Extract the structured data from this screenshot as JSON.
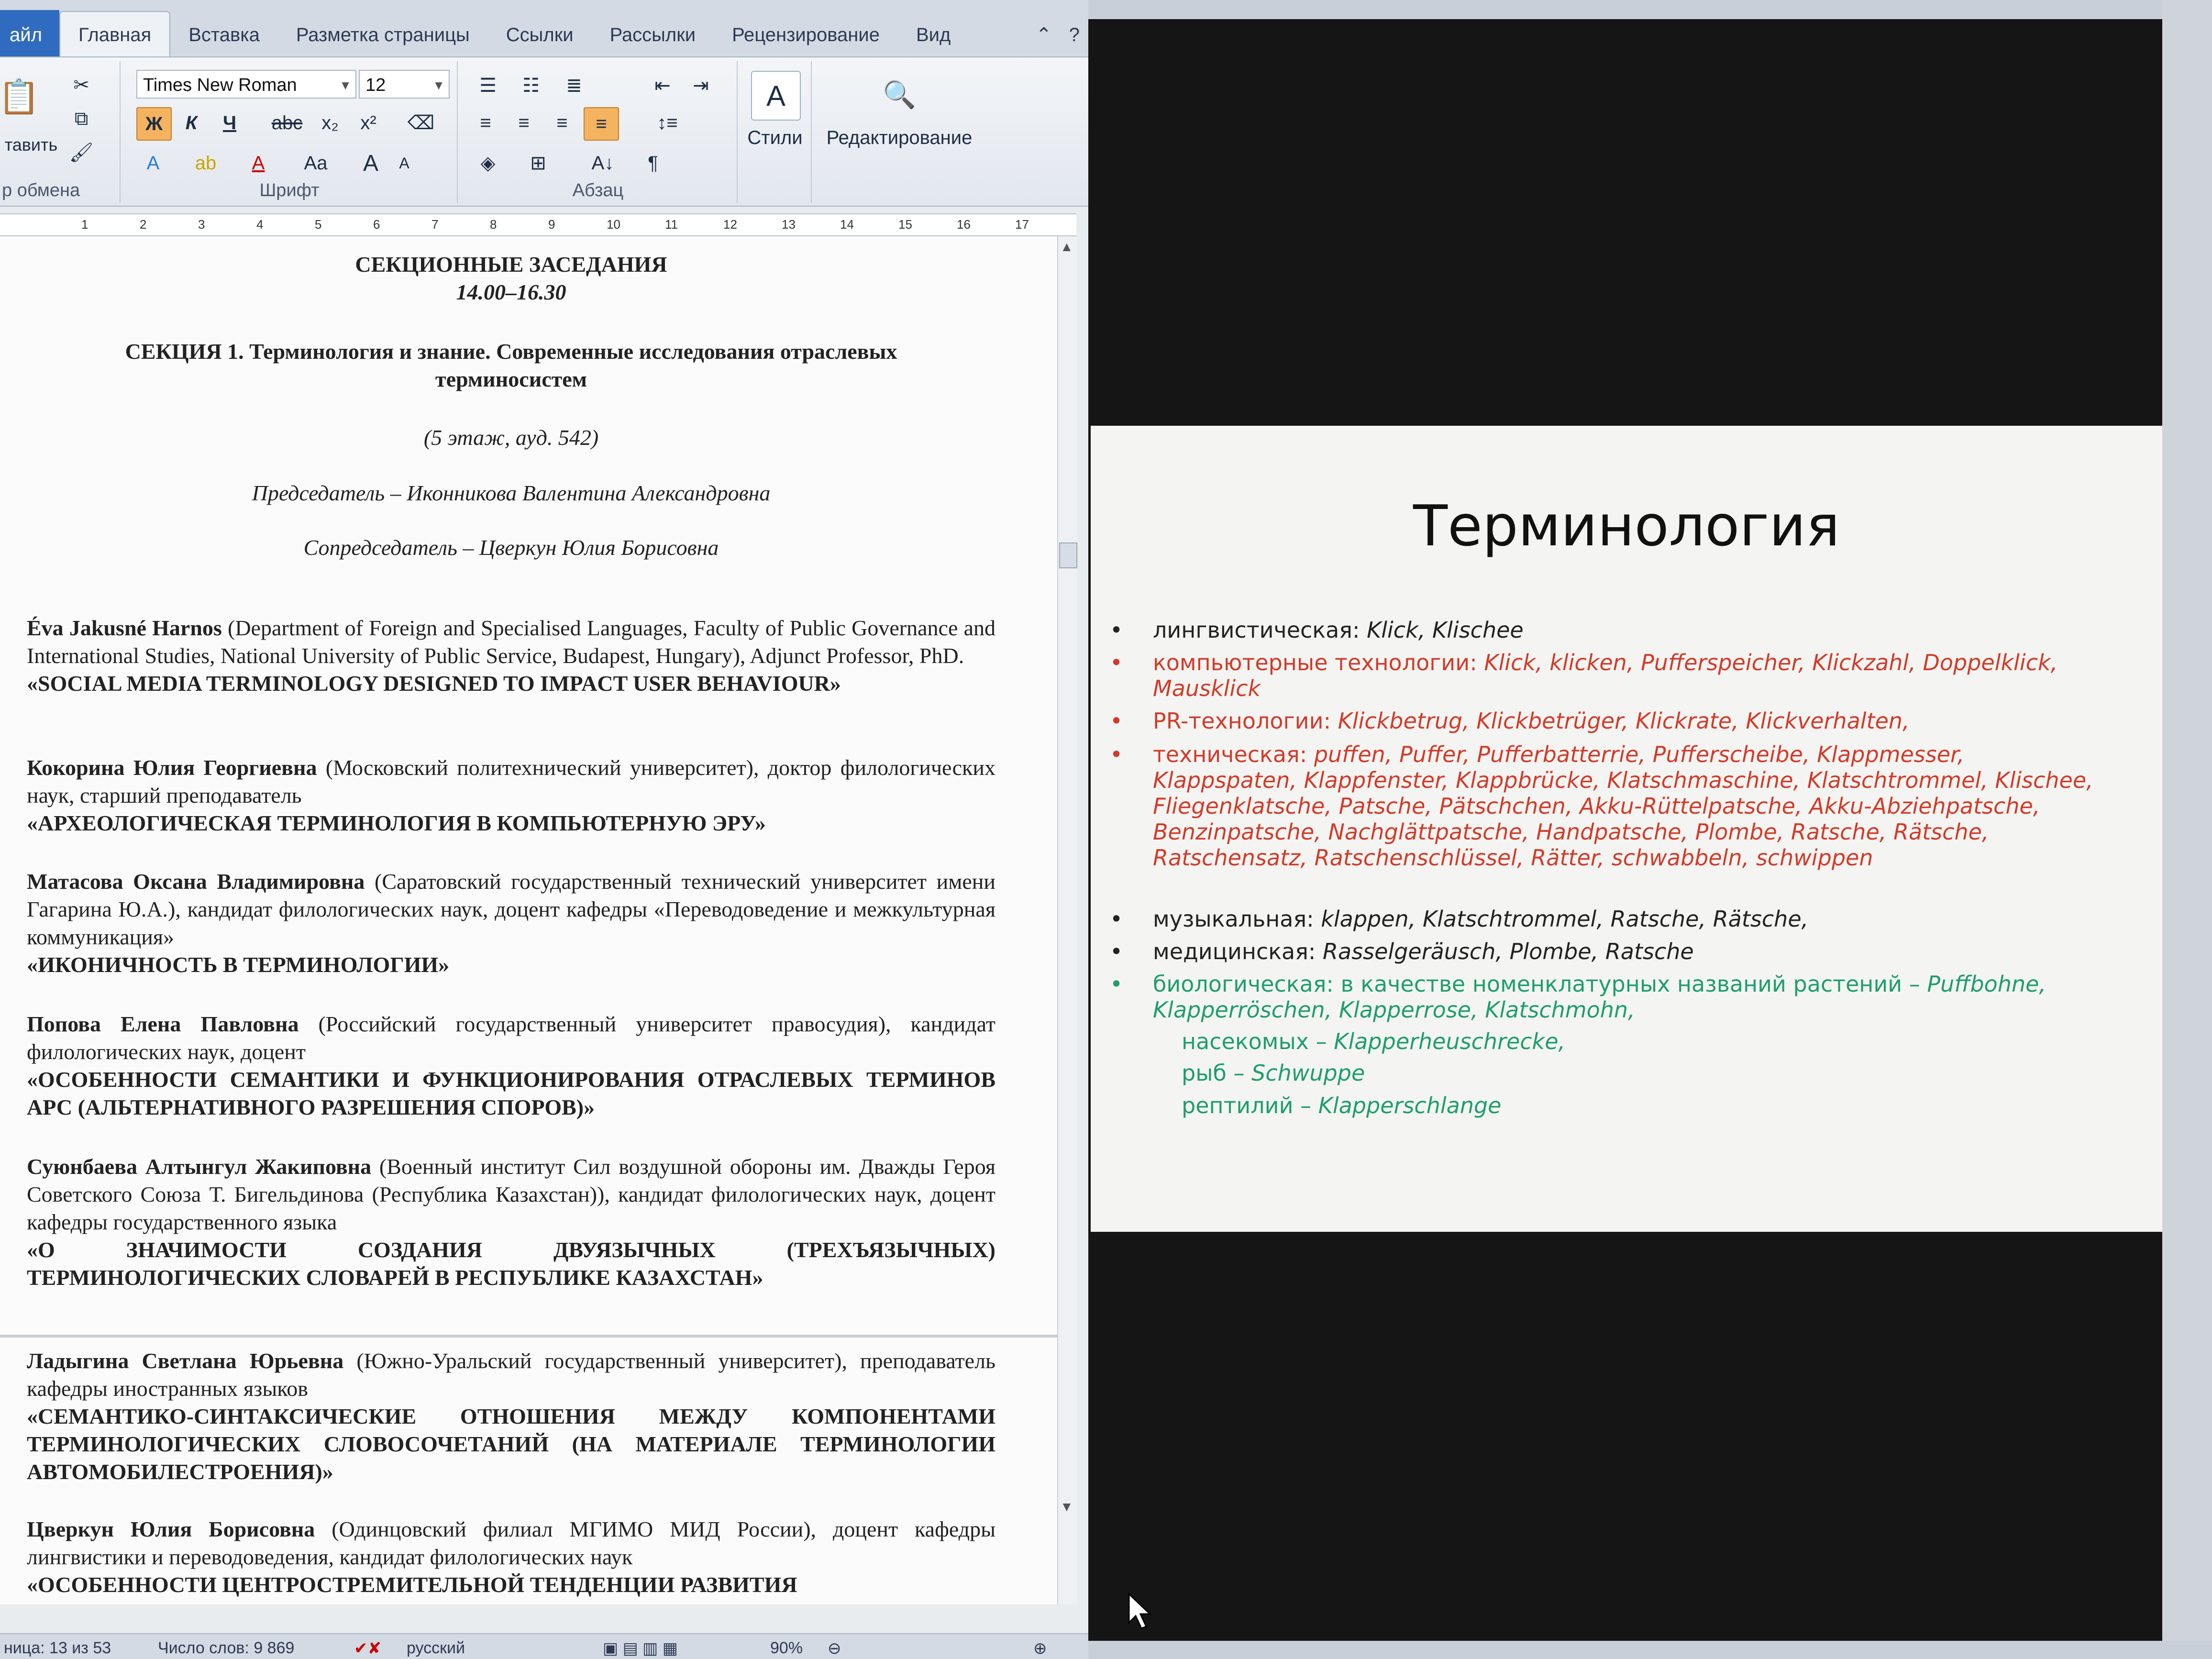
{
  "word": {
    "tabs": [
      "айл",
      "Главная",
      "Вставка",
      "Разметка страницы",
      "Ссылки",
      "Рассылки",
      "Рецензирование",
      "Вид"
    ],
    "ribbon": {
      "paste_label": "тавить",
      "clipboard_label": "р обмена",
      "font_name": "Times New Roman",
      "font_size": "12",
      "font_group_label": "Шрифт",
      "paragraph_group_label": "Абзац",
      "styles_label": "Стили",
      "editing_label": "Редактирование",
      "bold": "Ж",
      "italic": "К",
      "underline": "Ч",
      "strike": "abc",
      "sub": "x₂",
      "sup": "x²",
      "grow": "A",
      "shrink": "A",
      "case": "Aa",
      "pilcrow": "¶",
      "sort": "A↓"
    },
    "ruler_ticks": [
      "1",
      "2",
      "3",
      "4",
      "5",
      "6",
      "7",
      "8",
      "9",
      "10",
      "11",
      "12",
      "13",
      "14",
      "15",
      "16",
      "17"
    ],
    "doc": {
      "heading1": "СЕКЦИОННЫЕ ЗАСЕДАНИЯ",
      "time": "14.00–16.30",
      "section": "СЕКЦИЯ 1. Терминология и знание. Современные исследования отраслевых терминосистем",
      "location": "(5 этаж, ауд. 542)",
      "chair": "Председатель – Иконникова Валентина Александровна",
      "cochair": "Сопредседатель – Цверкун Юлия Борисовна",
      "entries": [
        {
          "name": "Éva Jakusné Harnos",
          "info": " (Department of Foreign and Specialised Languages, Faculty of Public Governance and International Studies, National University of Public Service, Budapest, Hungary), Adjunct Professor, PhD.",
          "title": "«SOCIAL MEDIA TERMINOLOGY DESIGNED TO IMPACT USER BEHAVIOUR»"
        },
        {
          "name": "Кокорина Юлия Георгиевна",
          "info": " (Московский политехнический университет), доктор филологических наук, старший преподаватель",
          "title": "«АРХЕОЛОГИЧЕСКАЯ ТЕРМИНОЛОГИЯ В КОМПЬЮТЕРНУЮ ЭРУ»"
        },
        {
          "name": "Матасова Оксана Владимировна",
          "info": " (Саратовский государственный технический университет имени Гагарина Ю.А.), кандидат филологических наук, доцент кафедры «Переводоведение и межкультурная коммуникация»",
          "title": "«ИКОНИЧНОСТЬ В ТЕРМИНОЛОГИИ»"
        },
        {
          "name": "Попова Елена Павловна",
          "info": " (Российский государственный университет правосудия), кандидат филологических наук, доцент",
          "title": "«ОСОБЕННОСТИ СЕМАНТИКИ И ФУНКЦИОНИРОВАНИЯ ОТРАСЛЕВЫХ ТЕРМИНОВ АРС (АЛЬТЕРНАТИВНОГО РАЗРЕШЕНИЯ СПОРОВ)»"
        },
        {
          "name": "Суюнбаева Алтынгул Жакиповна",
          "info": " (Военный институт Сил воздушной обороны им. Дважды Героя Советского Союза Т. Бигельдинова (Республика Казахстан)), кандидат филологических наук, доцент кафедры государственного языка",
          "title": "«О ЗНАЧИМОСТИ СОЗДАНИЯ ДВУЯЗЫЧНЫХ (ТРЕХЪЯЗЫЧНЫХ) ТЕРМИНОЛОГИЧЕСКИХ СЛОВАРЕЙ В РЕСПУБЛИКЕ КАЗАХСТАН»"
        },
        {
          "name": "Ладыгина Светлана Юрьевна",
          "info": " (Южно-Уральский государственный университет), преподаватель кафедры иностранных языков",
          "title": "«СЕМАНТИКО-СИНТАКСИЧЕСКИЕ ОТНОШЕНИЯ МЕЖДУ КОМПОНЕНТАМИ ТЕРМИНОЛОГИЧЕСКИХ СЛОВОСОЧЕТАНИЙ (НА МАТЕРИАЛЕ ТЕРМИНОЛОГИИ АВТОМОБИЛЕСТРОЕНИЯ)»"
        },
        {
          "name": "Цверкун Юлия Борисовна",
          "info": " (Одинцовский филиал МГИМО МИД России), доцент кафедры лингвистики и переводоведения, кандидат филологических наук",
          "title": "«ОСОБЕННОСТИ ЦЕНТРОСТРЕМИТЕЛЬНОЙ ТЕНДЕНЦИИ РАЗВИТИЯ"
        }
      ]
    },
    "status": {
      "page": "ница: 13 из 53",
      "words": "Число слов: 9 869",
      "lang": "русский",
      "zoom": "90%"
    }
  },
  "slide": {
    "title": "Терминология",
    "bullets": [
      {
        "label": "лингвистическая: ",
        "terms": "Klick, Klischee",
        "color": "#222222"
      },
      {
        "label": "компьютерные технологии: ",
        "terms": "Klick, klicken, Pufferspeicher, Klickzahl, Doppelklick, Mausklick",
        "color": "#d43a2a"
      },
      {
        "label": "PR-технологии: ",
        "terms": "Klickbetrug, Klickbetrüger, Klickrate, Klickverhalten,",
        "color": "#d43a2a"
      },
      {
        "label": "техническая: ",
        "terms": "puffen, Puffer, Pufferbatterrie, Pufferscheibe, Klappmesser, Klappspaten, Klappfenster, Klappbrücke, Klatschmaschine, Klatschtrommel, Klischee, Fliegenklatsche, Patsche, Pätschchen, Akku-Rüttelpatsche, Akku-Abziehpatsche, Benzinpatsche, Nachglättpatsche, Handpatsche, Plombe, Ratsche, Rätsche, Ratschensatz, Ratschenschlüssel, Rätter, schwabbeln, schwippen",
        "color": "#d43a2a"
      },
      {
        "label": "музыкальная: ",
        "terms": "klappen, Klatschtrommel, Ratsche, Rätsche,",
        "color": "#222222"
      },
      {
        "label": "медицинская: ",
        "terms": "Rasselgeräusch, Plombe, Ratsche",
        "color": "#222222"
      },
      {
        "label": "биологическая: в качестве номенклатурных названий растений – ",
        "terms": "Puffbohne, Klapperröschen, Klapperrose, Klatschmohn,",
        "color": "#1f9e6b"
      }
    ],
    "extra_lines": [
      {
        "label": "насекомых – ",
        "terms": "Klapperheuschrecke,"
      },
      {
        "label": "рыб – ",
        "terms": "Schwuppe"
      },
      {
        "label": "рептилий – ",
        "terms": "Klapperschlange"
      }
    ]
  }
}
